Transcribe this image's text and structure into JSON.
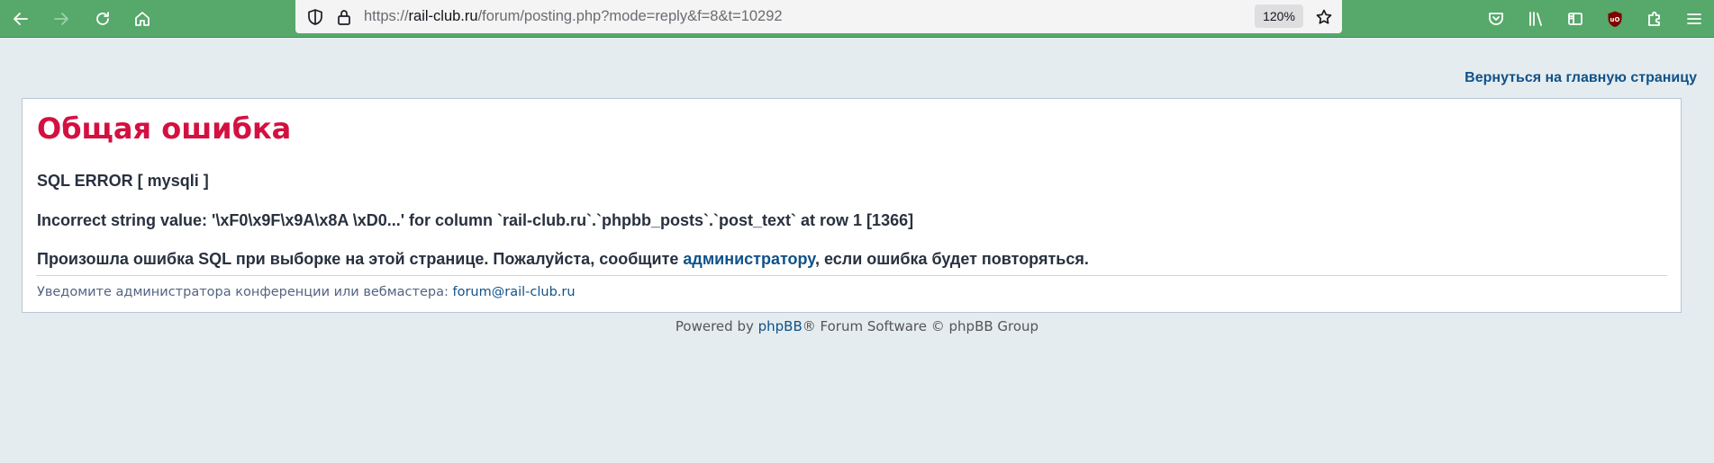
{
  "browser": {
    "url_prefix": "https://",
    "url_host": "rail-club.ru",
    "url_path": "/forum/posting.php?mode=reply&f=8&t=10292",
    "zoom": "120%",
    "colors": {
      "toolbar": "#56a96a",
      "urlbar": "#f4f4f5"
    },
    "icons": {
      "back": "back-arrow-icon",
      "forward": "forward-arrow-icon",
      "reload": "reload-icon",
      "home": "home-icon",
      "tracking": "shield-icon",
      "lock": "lock-icon",
      "bookmark": "star-icon",
      "pocket": "pocket-icon",
      "library": "library-icon",
      "sidebar": "sidebar-icon",
      "ublock": "ublock-origin-icon",
      "extensions": "puzzle-icon",
      "menu": "hamburger-menu-icon"
    }
  },
  "page": {
    "back_link": "Вернуться на главную страницу",
    "error_title": "Общая ошибка",
    "sql_error": "SQL ERROR [ mysqli ]",
    "error_detail": "Incorrect string value: '\\xF0\\x9F\\x9A\\x8A \\xD0...' for column `rail-club.ru`.`phpbb_posts`.`post_text` at row 1 [1366]",
    "message_before": "Произошла ошибка SQL при выборке на этой странице. Пожалуйста, сообщите ",
    "message_link": "администратору",
    "message_after": ", если ошибка будет повторяться.",
    "notify_text": "Уведомите администратора конференции или вебмастера: ",
    "notify_email": "forum@rail-club.ru",
    "colors": {
      "background": "#e4ecef",
      "title": "#d31141",
      "link": "#105289"
    }
  },
  "footer": {
    "powered_by": "Powered by ",
    "phpbb_link": "phpBB",
    "rest": "® Forum Software © phpBB Group"
  }
}
